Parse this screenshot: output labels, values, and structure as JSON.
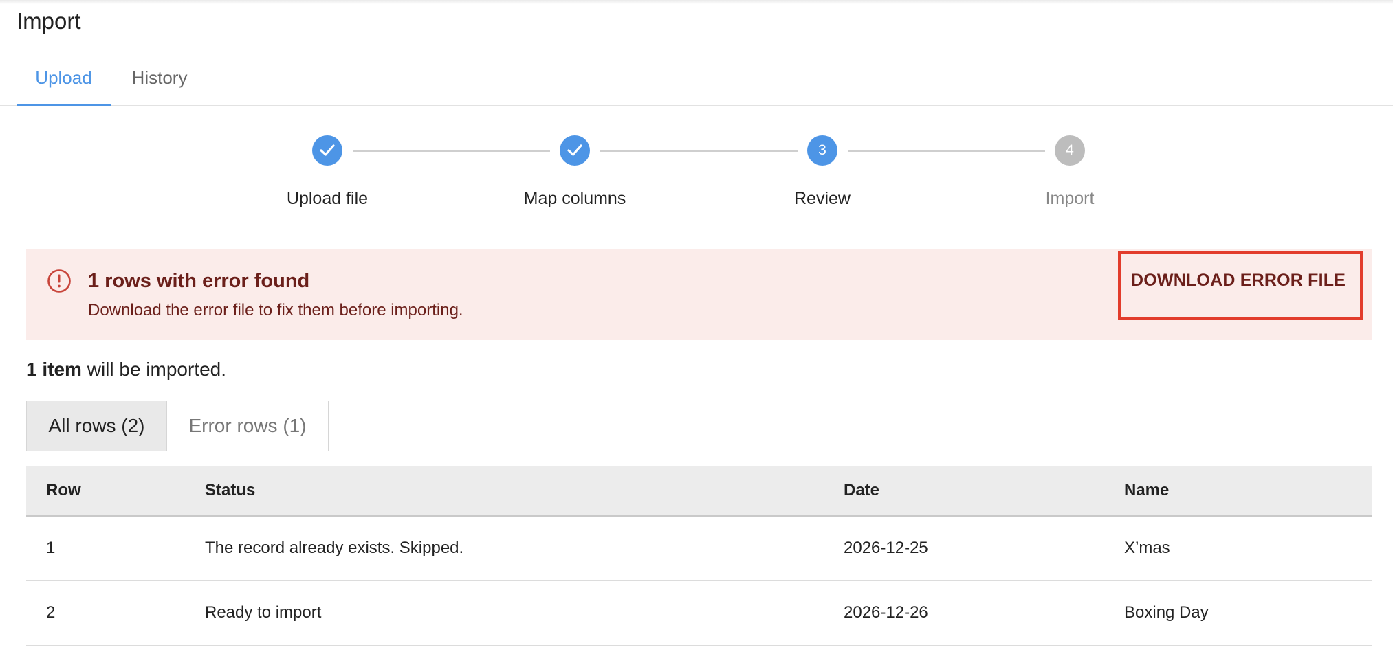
{
  "page": {
    "title": "Import"
  },
  "tabs": [
    {
      "label": "Upload",
      "active": true
    },
    {
      "label": "History",
      "active": false
    }
  ],
  "stepper": {
    "steps": [
      {
        "number": "1",
        "label": "Upload file",
        "state": "done"
      },
      {
        "number": "2",
        "label": "Map columns",
        "state": "done"
      },
      {
        "number": "3",
        "label": "Review",
        "state": "active"
      },
      {
        "number": "4",
        "label": "Import",
        "state": "pending"
      }
    ]
  },
  "alert": {
    "icon": "error-circle-icon",
    "title": "1 rows with error found",
    "body": "Download the error file to fix them before importing.",
    "button_label": "DOWNLOAD ERROR FILE"
  },
  "summary": {
    "count": "1 item",
    "text": " will be imported."
  },
  "filters": [
    {
      "label": "All rows (2)",
      "selected": true
    },
    {
      "label": "Error rows (1)",
      "selected": false
    }
  ],
  "table": {
    "headers": [
      "Row",
      "Status",
      "Date",
      "Name"
    ],
    "rows": [
      [
        "1",
        "The record already exists. Skipped.",
        "2026-12-25",
        "X’mas"
      ],
      [
        "2",
        "Ready to import",
        "2026-12-26",
        "Boxing Day"
      ]
    ]
  },
  "colors": {
    "accent": "#4d95e6",
    "alert_bg": "#fbecea",
    "alert_text": "#6b1f1a",
    "highlight": "#e23c2c"
  }
}
